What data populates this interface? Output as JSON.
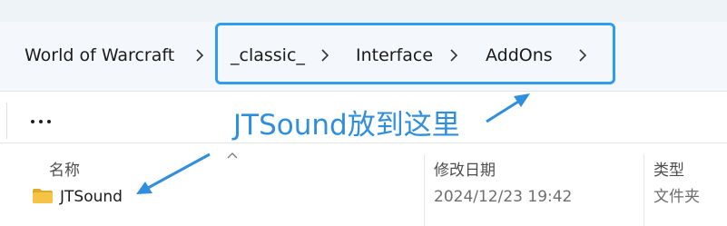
{
  "breadcrumb": {
    "items": [
      {
        "label": "World of Warcraft"
      },
      {
        "label": "_classic_"
      },
      {
        "label": "Interface"
      },
      {
        "label": "AddOns"
      }
    ]
  },
  "annotation": {
    "text": "JTSound放到这里",
    "color": "#2f8fdc",
    "highlight_color": "#2e9cf0"
  },
  "file_list": {
    "columns": {
      "name": "名称",
      "date": "修改日期",
      "type": "类型"
    },
    "rows": [
      {
        "name": "JTSound",
        "date": "2024/12/23 19:42",
        "type": "文件夹"
      }
    ]
  },
  "icons": {
    "more": "more-icon",
    "chevron": "chevron-right-icon",
    "folder": "folder-icon",
    "sort": "sort-up-icon"
  }
}
